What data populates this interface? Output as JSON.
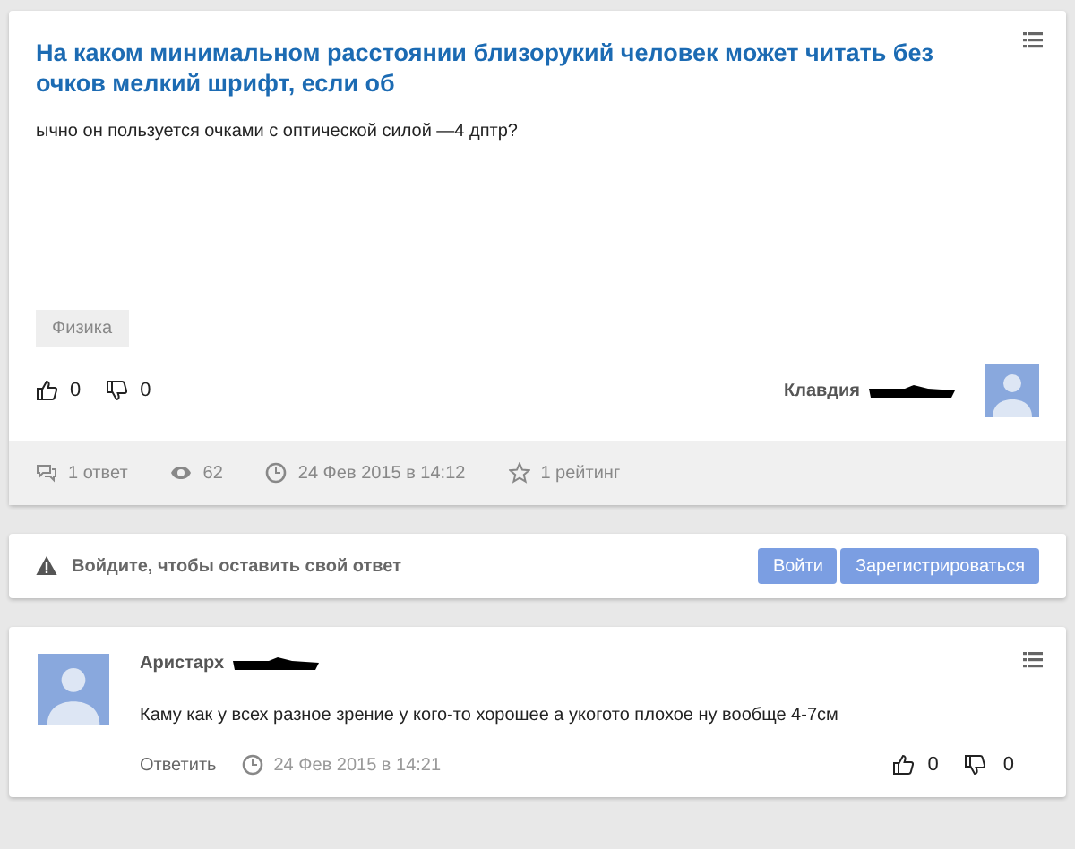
{
  "question": {
    "title": "На каком минимальном расстоянии близорукий человек может читать без очков мелкий шрифт, если об",
    "body": "ычно он пользуется очками с оптической силой —4 дптр?",
    "tag": "Физика",
    "likes": "0",
    "dislikes": "0",
    "author": "Клавдия",
    "author_redacted": true,
    "stats": [
      {
        "kind": "answers",
        "text": "1 ответ"
      },
      {
        "kind": "views",
        "text": "62"
      },
      {
        "kind": "date",
        "text": "24 Фев 2015 в 14:12"
      },
      {
        "kind": "rating",
        "text": "1 рейтинг"
      }
    ]
  },
  "login_bar": {
    "message": "Войдите, чтобы оставить свой ответ",
    "buttons": [
      "Войти",
      "Зарегистрироваться"
    ]
  },
  "answers": [
    {
      "author": "Аристарх",
      "author_redacted": true,
      "text": "Каму как у всех разное зрение у кого-то хорошее а укогото плохое ну вообще 4-7см",
      "reply": "Ответить",
      "date": "24 Фев 2015 в 14:21",
      "likes": "0",
      "dislikes": "0"
    }
  ]
}
